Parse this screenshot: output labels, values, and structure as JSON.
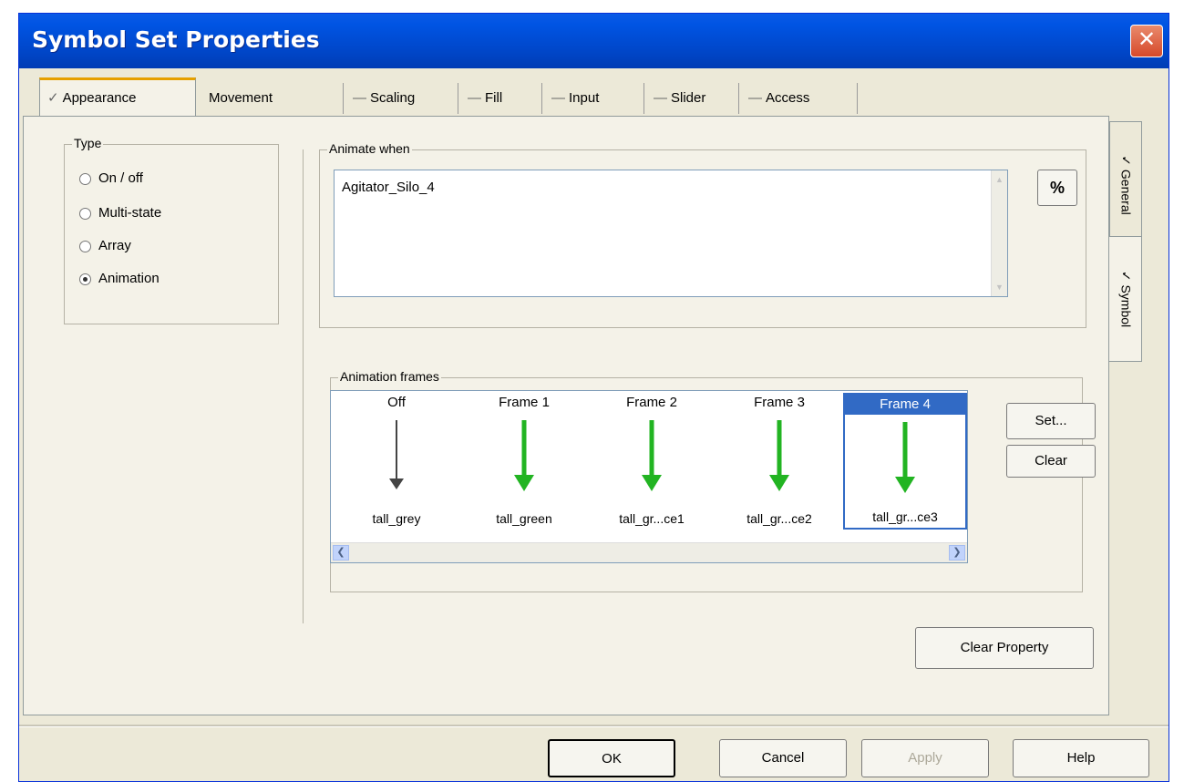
{
  "window": {
    "title": "Symbol Set Properties",
    "close_glyph": "✕"
  },
  "tabs": [
    {
      "label": "Appearance",
      "mark": "✓",
      "active": true
    },
    {
      "label": "Movement",
      "mark": "",
      "active": false
    },
    {
      "label": "Scaling",
      "mark": "—",
      "active": false
    },
    {
      "label": "Fill",
      "mark": "—",
      "active": false
    },
    {
      "label": "Input",
      "mark": "—",
      "active": false
    },
    {
      "label": "Slider",
      "mark": "—",
      "active": false
    },
    {
      "label": "Access",
      "mark": "—",
      "active": false
    }
  ],
  "type_group": {
    "title": "Type",
    "options": [
      {
        "label": "On / off",
        "checked": false
      },
      {
        "label": "Multi-state",
        "checked": false
      },
      {
        "label": "Array",
        "checked": false
      },
      {
        "label": "Animation",
        "checked": true
      }
    ]
  },
  "animate_when": {
    "title": "Animate when",
    "value": "Agitator_Silo_4",
    "browse_label": "%"
  },
  "frames_group": {
    "title": "Animation frames",
    "frames": [
      {
        "title": "Off",
        "name": "tall_grey",
        "color": "#444444",
        "selected": false
      },
      {
        "title": "Frame 1",
        "name": "tall_green",
        "color": "#22b422",
        "selected": false
      },
      {
        "title": "Frame 2",
        "name": "tall_gr...ce1",
        "color": "#22b422",
        "selected": false
      },
      {
        "title": "Frame 3",
        "name": "tall_gr...ce2",
        "color": "#22b422",
        "selected": false
      },
      {
        "title": "Frame 4",
        "name": "tall_gr...ce3",
        "color": "#22b422",
        "selected": true
      }
    ],
    "scroll_left": "❮",
    "scroll_right": "❯",
    "set_label": "Set...",
    "clear_label": "Clear"
  },
  "clear_property_label": "Clear Property",
  "side_tabs": [
    {
      "label": "General",
      "mark": "✓",
      "active": false
    },
    {
      "label": "Symbol",
      "mark": "✓",
      "active": true
    }
  ],
  "buttons": {
    "ok": "OK",
    "cancel": "Cancel",
    "apply": "Apply",
    "help": "Help"
  }
}
